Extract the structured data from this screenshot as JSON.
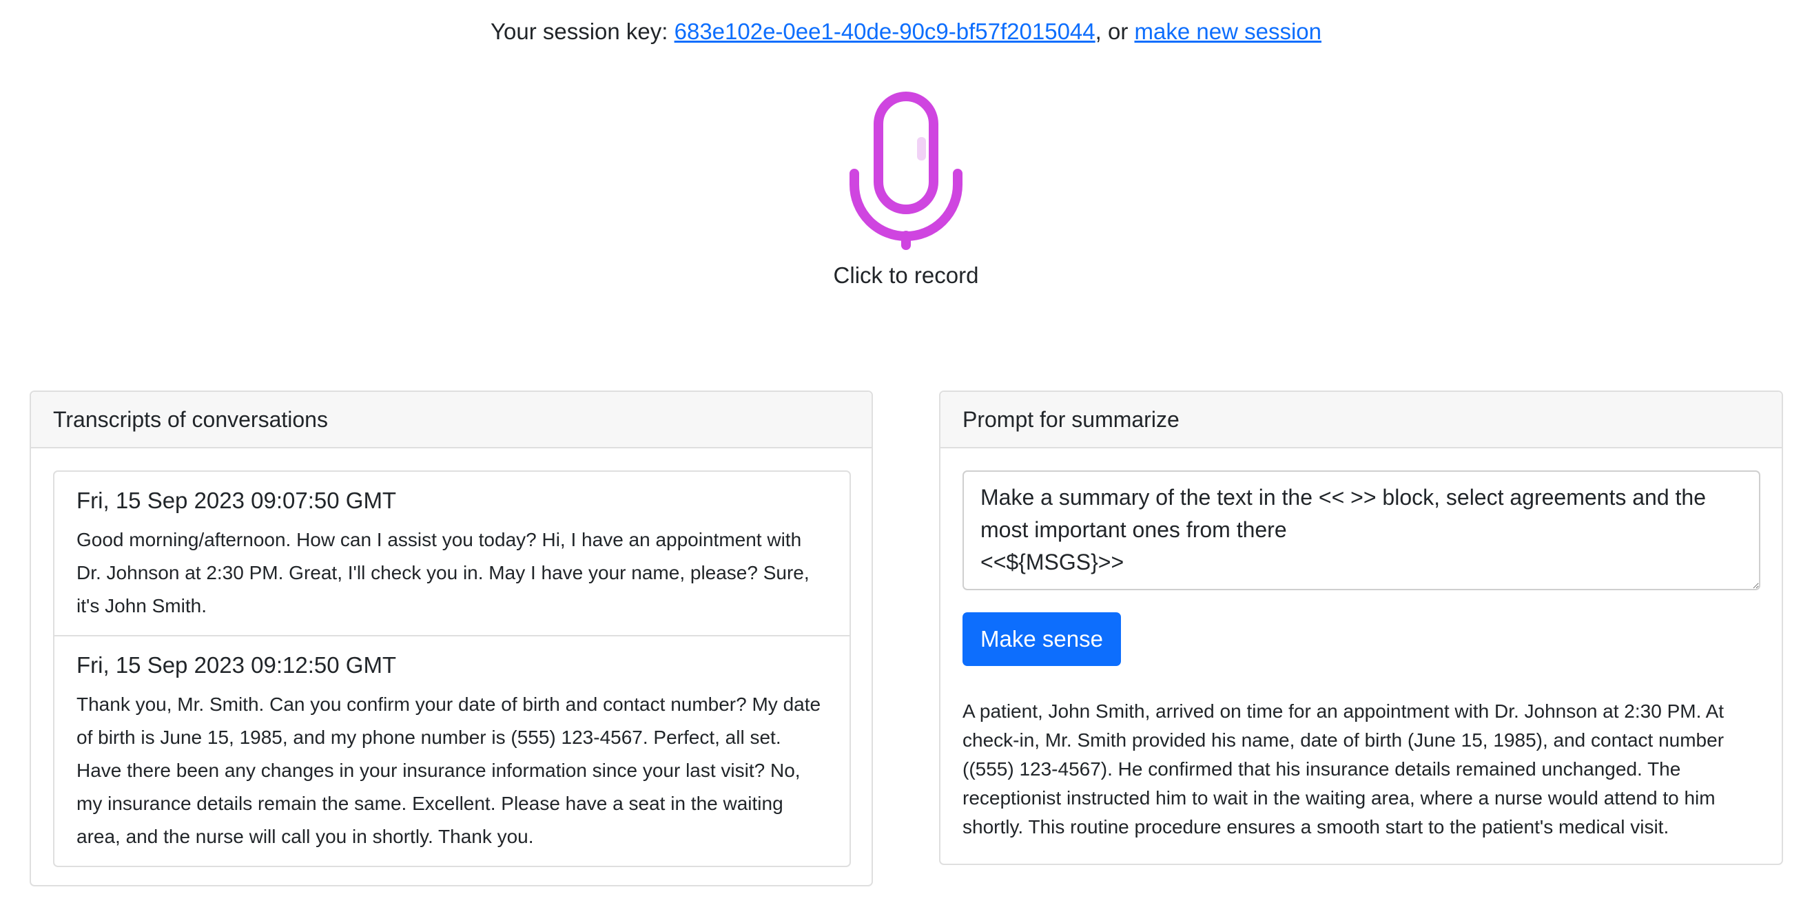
{
  "session": {
    "prefix": "Your session key: ",
    "key": "683e102e-0ee1-40de-90c9-bf57f2015044",
    "separator": ", or ",
    "new_session_link": "make new session"
  },
  "recorder": {
    "icon": "microphone-icon",
    "icon_color": "#cf45e0",
    "label": "Click to record"
  },
  "transcripts": {
    "title": "Transcripts of conversations",
    "items": [
      {
        "date": "Fri, 15 Sep 2023 09:07:50 GMT",
        "text": "Good morning/afternoon. How can I assist you today? Hi, I have an appointment with Dr. Johnson at 2:30 PM. Great, I'll check you in. May I have your name, please? Sure, it's John Smith."
      },
      {
        "date": "Fri, 15 Sep 2023 09:12:50 GMT",
        "text": "Thank you, Mr. Smith. Can you confirm your date of birth and contact number? My date of birth is June 15, 1985, and my phone number is (555) 123-4567. Perfect, all set. Have there been any changes in your insurance information since your last visit? No, my insurance details remain the same. Excellent. Please have a seat in the waiting area, and the nurse will call you in shortly. Thank you."
      }
    ]
  },
  "summarize": {
    "title": "Prompt for summarize",
    "prompt_value": "Make a summary of the text in the << >> block, select agreements and the most important ones from there\n<<${MSGS}>>",
    "button_label": "Make sense",
    "result": "A patient, John Smith, arrived on time for an appointment with Dr. Johnson at 2:30 PM. At check-in, Mr. Smith provided his name, date of birth (June 15, 1985), and contact number ((555) 123-4567). He confirmed that his insurance details remained unchanged. The receptionist instructed him to wait in the waiting area, where a nurse would attend to him shortly. This routine procedure ensures a smooth start to the patient's medical visit."
  },
  "colors": {
    "link": "#0d6efd",
    "button": "#0d6efd",
    "microphone": "#cf45e0"
  }
}
